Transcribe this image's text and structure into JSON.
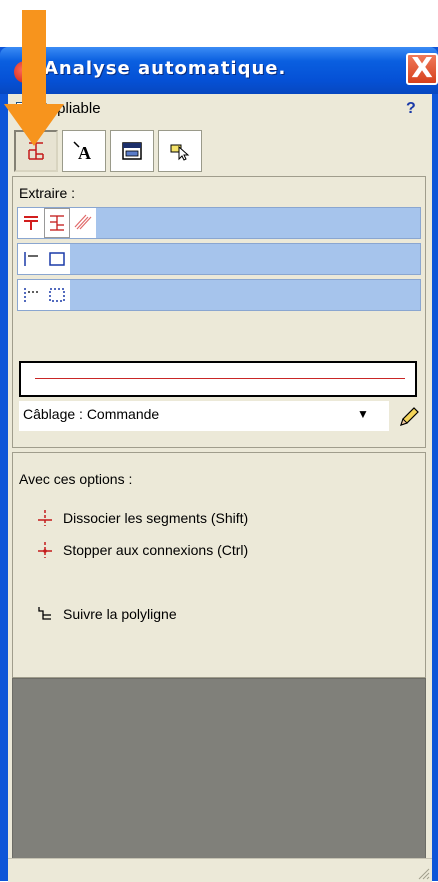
{
  "window": {
    "title": "Analyse automatique.",
    "close_label": "X"
  },
  "header": {
    "repliable_label": "Repliable",
    "help_label": "?"
  },
  "toolbar": {
    "items": [
      {
        "icon": "wire-extract-icon",
        "active": true
      },
      {
        "icon": "text-cursor-icon",
        "active": false
      },
      {
        "icon": "component-box-icon",
        "active": false
      },
      {
        "icon": "pointer-select-icon",
        "active": false
      }
    ]
  },
  "extract": {
    "label": "Extraire :",
    "rows": [
      {
        "icons": [
          "stacked-lines-icon",
          "wire-branch-icon",
          "diagonal-lines-icon"
        ]
      },
      {
        "icons": [
          "solid-line-icon",
          "solid-rect-icon"
        ]
      },
      {
        "icons": [
          "dashed-line-icon",
          "dashed-rect-icon"
        ]
      }
    ],
    "line_color": "#c92626",
    "selected_type": "Câblage : Commande"
  },
  "options": {
    "title": "Avec ces options :",
    "items": [
      {
        "label": "Dissocier les segments (Shift)",
        "icon": "split-segment-icon"
      },
      {
        "label": "Stopper aux connexions (Ctrl)",
        "icon": "stop-connection-icon"
      },
      {
        "label": "Suivre la polyligne",
        "icon": "polyline-icon"
      }
    ]
  },
  "colors": {
    "titlebar": "#0551d6",
    "panel_bg": "#ece9d8",
    "row_blue": "#a6c4ec",
    "annotation_arrow": "#f7941d"
  }
}
